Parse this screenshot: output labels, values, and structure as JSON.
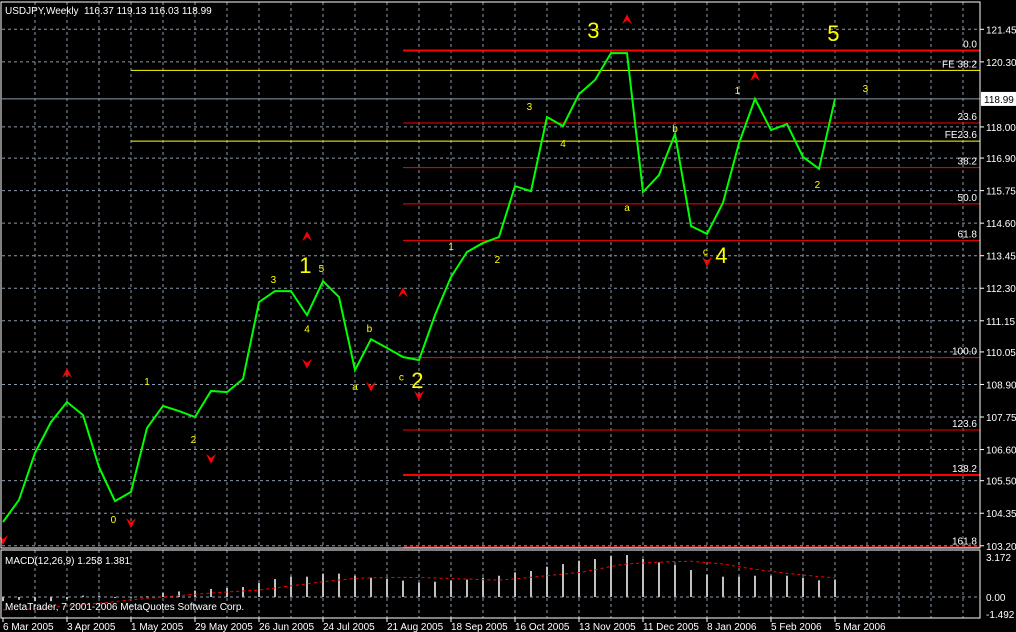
{
  "header": {
    "symbol_tf": "USDJPY,Weekly",
    "ohlc": "116.37 119.13 116.03 118.99"
  },
  "colors": {
    "bg": "#000000",
    "price": "#00ff00",
    "fib": "#ff0000",
    "fe": "#ffff00",
    "grid": "#8c9aa8",
    "wave": "#ffff00",
    "hist": "#c0c0c0",
    "signal": "#ff0000"
  },
  "chart_data": [
    {
      "type": "line",
      "title": "USDJPY,Weekly",
      "x_labels": [
        {
          "i": 0,
          "label": "6 Mar 2005"
        },
        {
          "i": 4,
          "label": "3 Apr 2005"
        },
        {
          "i": 8,
          "label": "1 May 2005"
        },
        {
          "i": 12,
          "label": "29 May 2005"
        },
        {
          "i": 16,
          "label": "26 Jun 2005"
        },
        {
          "i": 20,
          "label": "24 Jul 2005"
        },
        {
          "i": 24,
          "label": "21 Aug 2005"
        },
        {
          "i": 28,
          "label": "18 Sep 2005"
        },
        {
          "i": 32,
          "label": "16 Oct 2005"
        },
        {
          "i": 36,
          "label": "13 Nov 2005"
        },
        {
          "i": 40,
          "label": "11 Dec 2005"
        },
        {
          "i": 44,
          "label": "8 Jan 2006"
        },
        {
          "i": 48,
          "label": "5 Feb 2006"
        },
        {
          "i": 52,
          "label": "5 Mar 2006"
        }
      ],
      "y_ticks": [
        "121.45",
        "120.30",
        "118.00",
        "116.90",
        "115.75",
        "114.60",
        "113.45",
        "112.30",
        "111.15",
        "110.05",
        "108.90",
        "107.75",
        "106.60",
        "105.50",
        "104.35",
        "103.20"
      ],
      "ylim": [
        103.2,
        121.45
      ],
      "current_price": "118.99",
      "closes": [
        104.04,
        104.82,
        106.48,
        107.57,
        108.28,
        107.82,
        105.98,
        104.78,
        105.1,
        107.36,
        108.14,
        107.96,
        107.75,
        108.67,
        108.63,
        109.09,
        111.81,
        112.2,
        112.2,
        111.35,
        112.55,
        111.99,
        109.41,
        110.5,
        110.19,
        109.87,
        109.76,
        111.35,
        112.7,
        113.58,
        113.9,
        114.11,
        115.91,
        115.73,
        118.35,
        118.03,
        119.16,
        119.66,
        120.61,
        120.61,
        115.7,
        116.3,
        117.75,
        114.5,
        114.22,
        115.32,
        117.43,
        118.99,
        117.89,
        118.1,
        116.94,
        116.52,
        118.99
      ],
      "fib_start_i": 25,
      "fib_levels": [
        {
          "label": "0.0",
          "price": 120.7,
          "thick": true
        },
        {
          "label": "23.6",
          "price": 118.14,
          "thick": false
        },
        {
          "label": "38.2",
          "price": 116.56,
          "thick": false
        },
        {
          "label": "50.0",
          "price": 115.28,
          "thick": false
        },
        {
          "label": "61.8",
          "price": 113.99,
          "thick": false
        },
        {
          "label": "100.0",
          "price": 109.85,
          "thick": false
        },
        {
          "label": "123.6",
          "price": 107.29,
          "thick": false
        },
        {
          "label": "138.2",
          "price": 105.7,
          "thick": true
        },
        {
          "label": "161.8",
          "price": 103.14,
          "thick": true
        }
      ],
      "fe_start_i": 8,
      "fe_levels": [
        {
          "label": "FE 38.2",
          "price": 120.0
        },
        {
          "label": "FE23.6",
          "price": 117.5
        }
      ],
      "wave_labels_small": [
        {
          "t": "0",
          "i": 6.9,
          "p": 104.15
        },
        {
          "t": "1",
          "i": 9,
          "p": 109.03
        },
        {
          "t": "2",
          "i": 11.9,
          "p": 106.98
        },
        {
          "t": "3",
          "i": 16.9,
          "p": 112.63
        },
        {
          "t": "4",
          "i": 19,
          "p": 110.87
        },
        {
          "t": "5",
          "i": 19.9,
          "p": 113.02
        },
        {
          "t": "a",
          "i": 22,
          "p": 108.84
        },
        {
          "t": "b",
          "i": 22.9,
          "p": 110.89
        },
        {
          "t": "c",
          "i": 24.9,
          "p": 109.19
        },
        {
          "t": "1",
          "i": 28,
          "p": 113.79
        },
        {
          "t": "2",
          "i": 30.9,
          "p": 113.33
        },
        {
          "t": "3",
          "i": 32.9,
          "p": 118.74
        },
        {
          "t": "4",
          "i": 35,
          "p": 117.43
        },
        {
          "t": "a",
          "i": 39,
          "p": 115.17
        },
        {
          "t": "b",
          "i": 42,
          "p": 117.96
        },
        {
          "t": "c",
          "i": 43.9,
          "p": 113.61
        },
        {
          "t": "1",
          "i": 45.9,
          "p": 119.3
        },
        {
          "t": "2",
          "i": 50.9,
          "p": 115.98
        },
        {
          "t": "3",
          "i": 53.9,
          "p": 119.37
        }
      ],
      "wave_labels_large": [
        {
          "t": "1",
          "i": 18.9,
          "p": 113.12
        },
        {
          "t": "2",
          "i": 25.9,
          "p": 109.06
        },
        {
          "t": "3",
          "i": 36.9,
          "p": 121.43
        },
        {
          "t": "4",
          "i": 44.9,
          "p": 113.47
        },
        {
          "t": "5",
          "i": 51.9,
          "p": 121.32
        }
      ],
      "fractals_up": [
        {
          "i": 4,
          "p": 109.31
        },
        {
          "i": 19,
          "p": 114.14
        },
        {
          "i": 25,
          "p": 112.16
        },
        {
          "i": 39,
          "p": 121.81
        },
        {
          "i": 47,
          "p": 119.8
        }
      ],
      "fractals_down": [
        {
          "i": 0,
          "p": 103.4
        },
        {
          "i": 8,
          "p": 104.0
        },
        {
          "i": 13,
          "p": 106.27
        },
        {
          "i": 19,
          "p": 109.63
        },
        {
          "i": 23,
          "p": 108.82
        },
        {
          "i": 26,
          "p": 108.5
        },
        {
          "i": 44,
          "p": 113.23
        }
      ]
    },
    {
      "type": "bar",
      "title": "MACD(12,26,9) 1.258 1.381",
      "y_ticks": [
        "3.172",
        "0.00",
        "-1.492"
      ],
      "ylim": [
        -1.492,
        3.172
      ],
      "histogram": [
        -0.3,
        -0.2,
        -0.3,
        -0.3,
        -0.15,
        0.1,
        0.1,
        -0.05,
        0.02,
        0.05,
        0.3,
        0.4,
        0.46,
        0.58,
        0.65,
        0.72,
        1.0,
        1.29,
        1.46,
        1.46,
        1.68,
        1.68,
        1.53,
        1.39,
        1.32,
        1.18,
        1.03,
        1.1,
        1.18,
        1.25,
        1.39,
        1.53,
        1.77,
        1.87,
        2.18,
        2.37,
        2.61,
        2.73,
        2.97,
        3.02,
        2.73,
        2.49,
        2.3,
        1.94,
        1.61,
        1.46,
        1.46,
        1.53,
        1.53,
        1.53,
        1.39,
        1.2,
        1.258
      ],
      "signal": [
        -0.93,
        -0.9,
        -0.85,
        -0.75,
        -0.65,
        -0.55,
        -0.45,
        -0.33,
        -0.2,
        -0.1,
        0.0,
        0.1,
        0.2,
        0.28,
        0.36,
        0.43,
        0.5,
        0.65,
        0.8,
        0.95,
        1.1,
        1.22,
        1.34,
        1.38,
        1.4,
        1.41,
        1.4,
        1.37,
        1.33,
        1.29,
        1.25,
        1.22,
        1.3,
        1.42,
        1.53,
        1.65,
        1.76,
        1.95,
        2.2,
        2.38,
        2.45,
        2.51,
        2.55,
        2.57,
        2.47,
        2.37,
        2.18,
        1.99,
        1.85,
        1.7,
        1.58,
        1.47,
        1.381
      ]
    }
  ],
  "footer": {
    "copyright": "MetaTrader, 7 2001-2006 MetaQuotes Software Corp."
  }
}
